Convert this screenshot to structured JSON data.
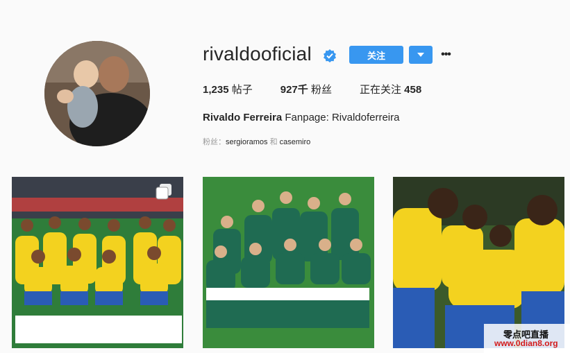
{
  "profile": {
    "username": "rivaldooficial",
    "follow_label": "关注",
    "stats": [
      {
        "value": "1,235",
        "label": "帖子"
      },
      {
        "value": "927千",
        "label": "粉丝"
      },
      {
        "prefix": "正在关注",
        "value": "458"
      }
    ],
    "bio_name": "Rivaldo Ferreira",
    "bio_text": "Fanpage: Rivaldoferreira",
    "followed_by_label": "粉丝：",
    "followed_by": [
      "sergioramos",
      "casemiro"
    ],
    "followed_by_joiner": "和"
  },
  "posts": [
    {
      "subject": "brazil-team-photo",
      "multi": true
    },
    {
      "subject": "germany-team-photo",
      "multi": false
    },
    {
      "subject": "brazil-players-huddle",
      "multi": false
    }
  ],
  "watermark": {
    "cn": "零点吧直播",
    "url": "www.0dian8.org"
  },
  "colors": {
    "accent": "#3897f0",
    "verified": "#3897f0",
    "brazil_yellow": "#f3d21f",
    "germany_green": "#1f6b52"
  }
}
